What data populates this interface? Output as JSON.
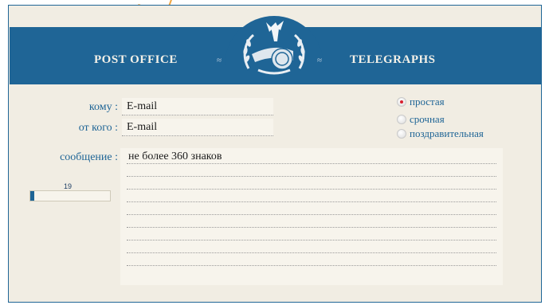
{
  "header": {
    "left_title": "POST OFFICE",
    "right_title": "TELEGRAPHS",
    "emblem_icon": "post-emblem-icon"
  },
  "form": {
    "to_label": "кому :",
    "to_value": "E-mail",
    "from_label": "от кого :",
    "from_value": "E-mail",
    "message_label": "сообщение :",
    "message_placeholder": "не более 360 знаков"
  },
  "telegram_type": {
    "options": [
      {
        "label": "простая",
        "checked": true
      },
      {
        "label": "срочная",
        "checked": false
      },
      {
        "label": "поздравительная",
        "checked": false
      }
    ]
  },
  "counter": {
    "value": "19",
    "progress_fraction": 0.05
  },
  "colors": {
    "accent": "#1f6596",
    "paper": "#f1ede3",
    "radio_selected": "#d8202f"
  }
}
